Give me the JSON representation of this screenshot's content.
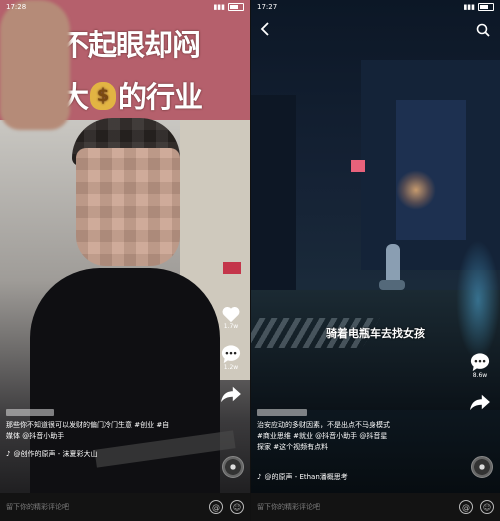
{
  "left": {
    "status_time": "17:28",
    "headline_line1": "看着不起眼却闷",
    "headline_line2_a": "声发大",
    "headline_line2_b": "的行业",
    "actions": {
      "like_count": "1.7w",
      "comment_count": "1.2w"
    },
    "caption_line1": "那些你不知道很可以发财的偏门冷门生意 #创业 #自",
    "caption_line2": "媒体 @抖音小助手",
    "music": "@创作的原声 - 沫夏彩大山",
    "comment_placeholder": "留下你的精彩评论吧"
  },
  "right": {
    "status_time": "17:27",
    "subtitle": "骑着电瓶车去找女孩",
    "actions": {
      "comment_count": "8.6w"
    },
    "caption_line1": "治安应动的多财因素，不是出点不马身模式",
    "caption_line2": "#商业思维 #就业 @抖音小助手 @抖音星",
    "caption_line3": "探家 #这个视频有点料",
    "music": "@的原声 - Ethan潘概思考",
    "comment_placeholder": "留下你的精彩评论吧"
  },
  "colors": {
    "headline_bg": "#b5606c",
    "night_bg": "#0c1420"
  },
  "icons": [
    "back-icon",
    "search-icon",
    "heart-icon",
    "comment-icon",
    "share-icon",
    "music-disc-icon",
    "at-icon",
    "emoji-icon"
  ]
}
